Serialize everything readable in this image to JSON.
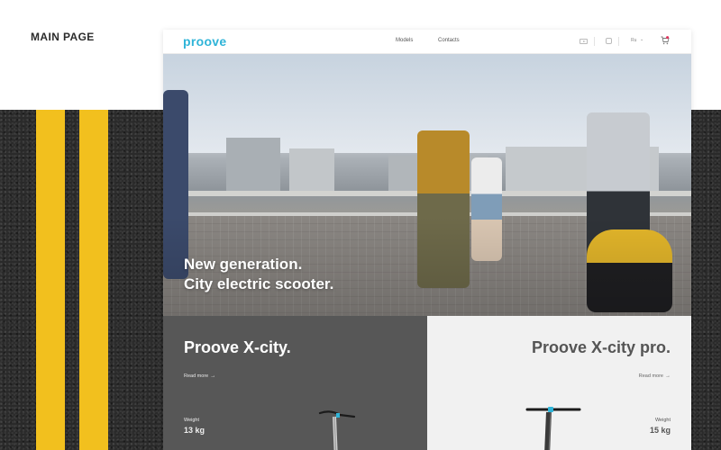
{
  "presentation": {
    "caption": "MAIN PAGE"
  },
  "nav": {
    "logo": "proove",
    "links": [
      "Models",
      "Contacts"
    ],
    "language": "Ru",
    "icons": [
      "youtube-icon",
      "instagram-icon",
      "cart-icon"
    ]
  },
  "hero": {
    "title_line1": "New generation.",
    "title_line2": "City electric scooter."
  },
  "products": [
    {
      "name": "Proove X-city.",
      "link": "Read more",
      "weight_label": "Weight",
      "weight": "13 kg"
    },
    {
      "name": "Proove X-city pro.",
      "link": "Read more",
      "weight_label": "Weight",
      "weight": "15 kg"
    }
  ],
  "colors": {
    "brand": "#2fb4d8",
    "cart_badge": "#e0315a",
    "road_line": "#f2c01e",
    "dark_panel": "#575757",
    "light_panel": "#f1f1f1"
  }
}
